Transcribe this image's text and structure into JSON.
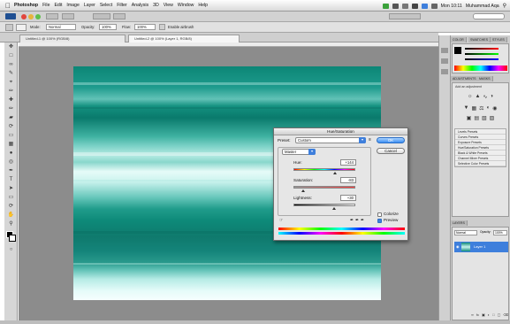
{
  "menubar": {
    "app": "Photoshop",
    "items": [
      "File",
      "Edit",
      "Image",
      "Layer",
      "Select",
      "Filter",
      "Analysis",
      "3D",
      "View",
      "Window",
      "Help"
    ],
    "clock": "Mon 10:11",
    "user": "Muhammad Aqa"
  },
  "options_bar": {
    "tool_label": "Mode:",
    "mode_value": "Normal",
    "opacity_label": "Opacity:",
    "opacity_value": "100%",
    "flow_label": "Flow:",
    "flow_value": "100%",
    "airbrush_label": "Enable airbrush"
  },
  "document_tabs": [
    "Untitled-1 @ 100% (RGB/8)",
    "Untitled-2 @ 100% (Layer 1, RGB/8)"
  ],
  "dialog": {
    "title": "Hue/Saturation",
    "preset_label": "Preset:",
    "preset_value": "Custom",
    "channel_value": "Master",
    "ok_label": "OK",
    "cancel_label": "Cancel",
    "hue_label": "Hue:",
    "hue_value": "+144",
    "saturation_label": "Saturation:",
    "saturation_value": "-83",
    "lightness_label": "Lightness:",
    "lightness_value": "+30",
    "colorize_label": "Colorize",
    "preview_label": "Preview",
    "colorize_checked": false,
    "preview_checked": true
  },
  "panels": {
    "color_tabs": [
      "COLOR",
      "SWATCHES",
      "STYLES"
    ],
    "adjust_tabs": [
      "ADJUSTMENTS",
      "MASKS"
    ],
    "adjust_title": "Add an adjustment",
    "presets": [
      "Levels Presets",
      "Curves Presets",
      "Exposure Presets",
      "Hue/Saturation Presets",
      "Black & White Presets",
      "Channel Mixer Presets",
      "Selective Color Presets"
    ],
    "layers_tab": "LAYERS",
    "blend_mode": "Normal",
    "opacity_label": "Opacity:",
    "opacity_value": "100%",
    "layer_name": "Layer 1"
  },
  "colors": {
    "accent": "#3e7fdc",
    "canvas_teal": "#0e8a79",
    "workspace": "#8c8c8c"
  }
}
